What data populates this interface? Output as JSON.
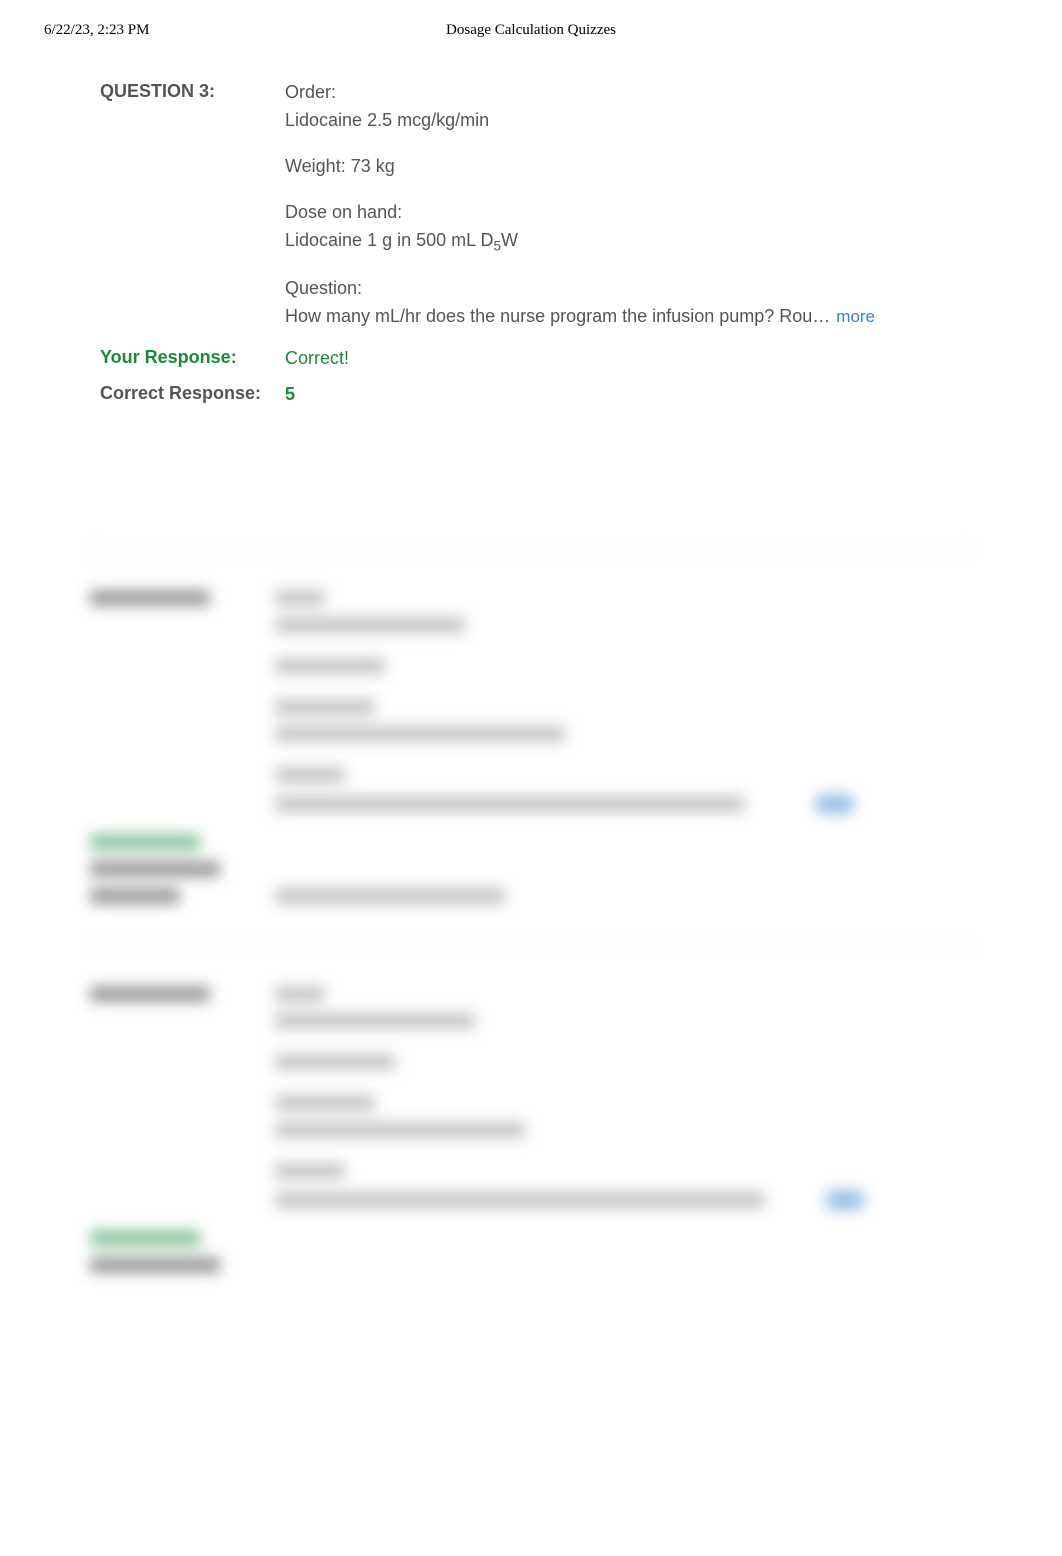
{
  "header": {
    "datetime": "6/22/23, 2:23 PM",
    "title": "Dosage Calculation Quizzes"
  },
  "question": {
    "label": "QUESTION 3:",
    "order_label": "Order:",
    "order_value": "Lidocaine 2.5 mcg/kg/min",
    "weight": "Weight: 73 kg",
    "dose_label": "Dose on hand:",
    "dose_value_pre": "Lidocaine 1 g in 500 mL D",
    "dose_sub": "5",
    "dose_value_post": "W",
    "q_label": "Question:",
    "q_text": "How many mL/hr does the nurse program the infusion pump? Rou…",
    "more": "more"
  },
  "your_response": {
    "label": "Your Response:",
    "value": "Correct!"
  },
  "correct_response": {
    "label": "Correct Response:",
    "value": "5"
  },
  "blurred": {
    "more": "more"
  }
}
